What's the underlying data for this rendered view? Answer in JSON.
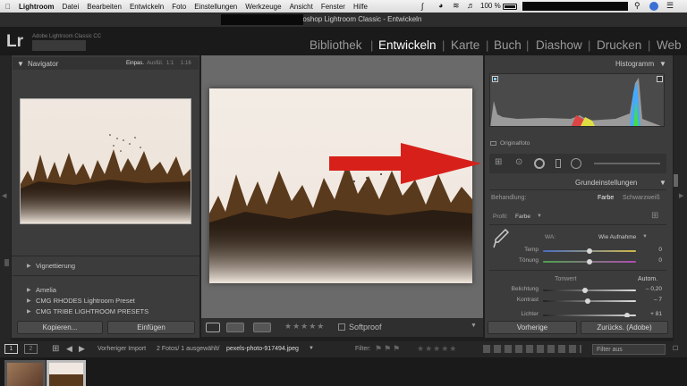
{
  "menubar": {
    "apple": "",
    "app": "Lightroom",
    "items": [
      "Datei",
      "Bearbeiten",
      "Entwickeln",
      "Foto",
      "Einstellungen",
      "Werkzeuge",
      "Ansicht",
      "Fenster",
      "Hilfe"
    ],
    "battery": "100 %"
  },
  "window": {
    "title": "Adobe Photoshop Lightroom Classic - Entwickeln"
  },
  "identity": {
    "logo": "Lr",
    "subtitle": "Adobe Lightroom Classic CC"
  },
  "modules": [
    "Bibliothek",
    "Entwickeln",
    "Karte",
    "Buch",
    "Diashow",
    "Drucken",
    "Web"
  ],
  "navigator": {
    "title": "Navigator",
    "zoom": [
      "Einpas.",
      "Ausfül.",
      "1:1",
      "1:16"
    ]
  },
  "left_panel": {
    "vignette": "Vignettierung",
    "presets": [
      "Amelia",
      "CMG RHODES Lightroom Preset",
      "CMG TRIBE LIGHTROOM PRESETS"
    ],
    "copy_button": "Kopieren...",
    "paste_button": "Einfügen"
  },
  "toolbar": {
    "softproof": "Softproof"
  },
  "histogram": {
    "title": "Histogramm",
    "original": "Originalfoto"
  },
  "basic": {
    "title": "Grundeinstellungen",
    "treatment_label": "Behandlung:",
    "color": "Farbe",
    "bw": "Schwarzweiß",
    "profile_label": "Profil:",
    "profile_value": "Farbe",
    "wb_label": "WA:",
    "wb_value": "Wie Aufnahme",
    "temp": "Temp",
    "temp_val": "0",
    "tint": "Tönung",
    "tint_val": "0",
    "tone": "Tonwert",
    "auto": "Autom.",
    "exposure": "Belichtung",
    "exposure_val": "– 0,20",
    "contrast": "Kontrast",
    "contrast_val": "– 7",
    "highlights": "Lichter",
    "highlights_val": "+ 81"
  },
  "right_buttons": {
    "previous": "Vorherige",
    "reset": "Zurücks. (Adobe)"
  },
  "filmstrip": {
    "pages": [
      "1",
      "2"
    ],
    "source": "Vorheriger Import",
    "count": "2 Fotos/ 1 ausgewählt/",
    "file": "pexels-photo-917494.jpeg",
    "filter_label": "Filter:",
    "filter_value": "Filter aus"
  },
  "colors": {
    "accent": "#d8201a",
    "panel": "#3c3c3c",
    "bg": "#1f1f1f"
  },
  "levels": {
    "temp": 0.5,
    "tint": 0.5,
    "exposure": 0.45,
    "contrast": 0.48,
    "highlights": 0.9
  }
}
